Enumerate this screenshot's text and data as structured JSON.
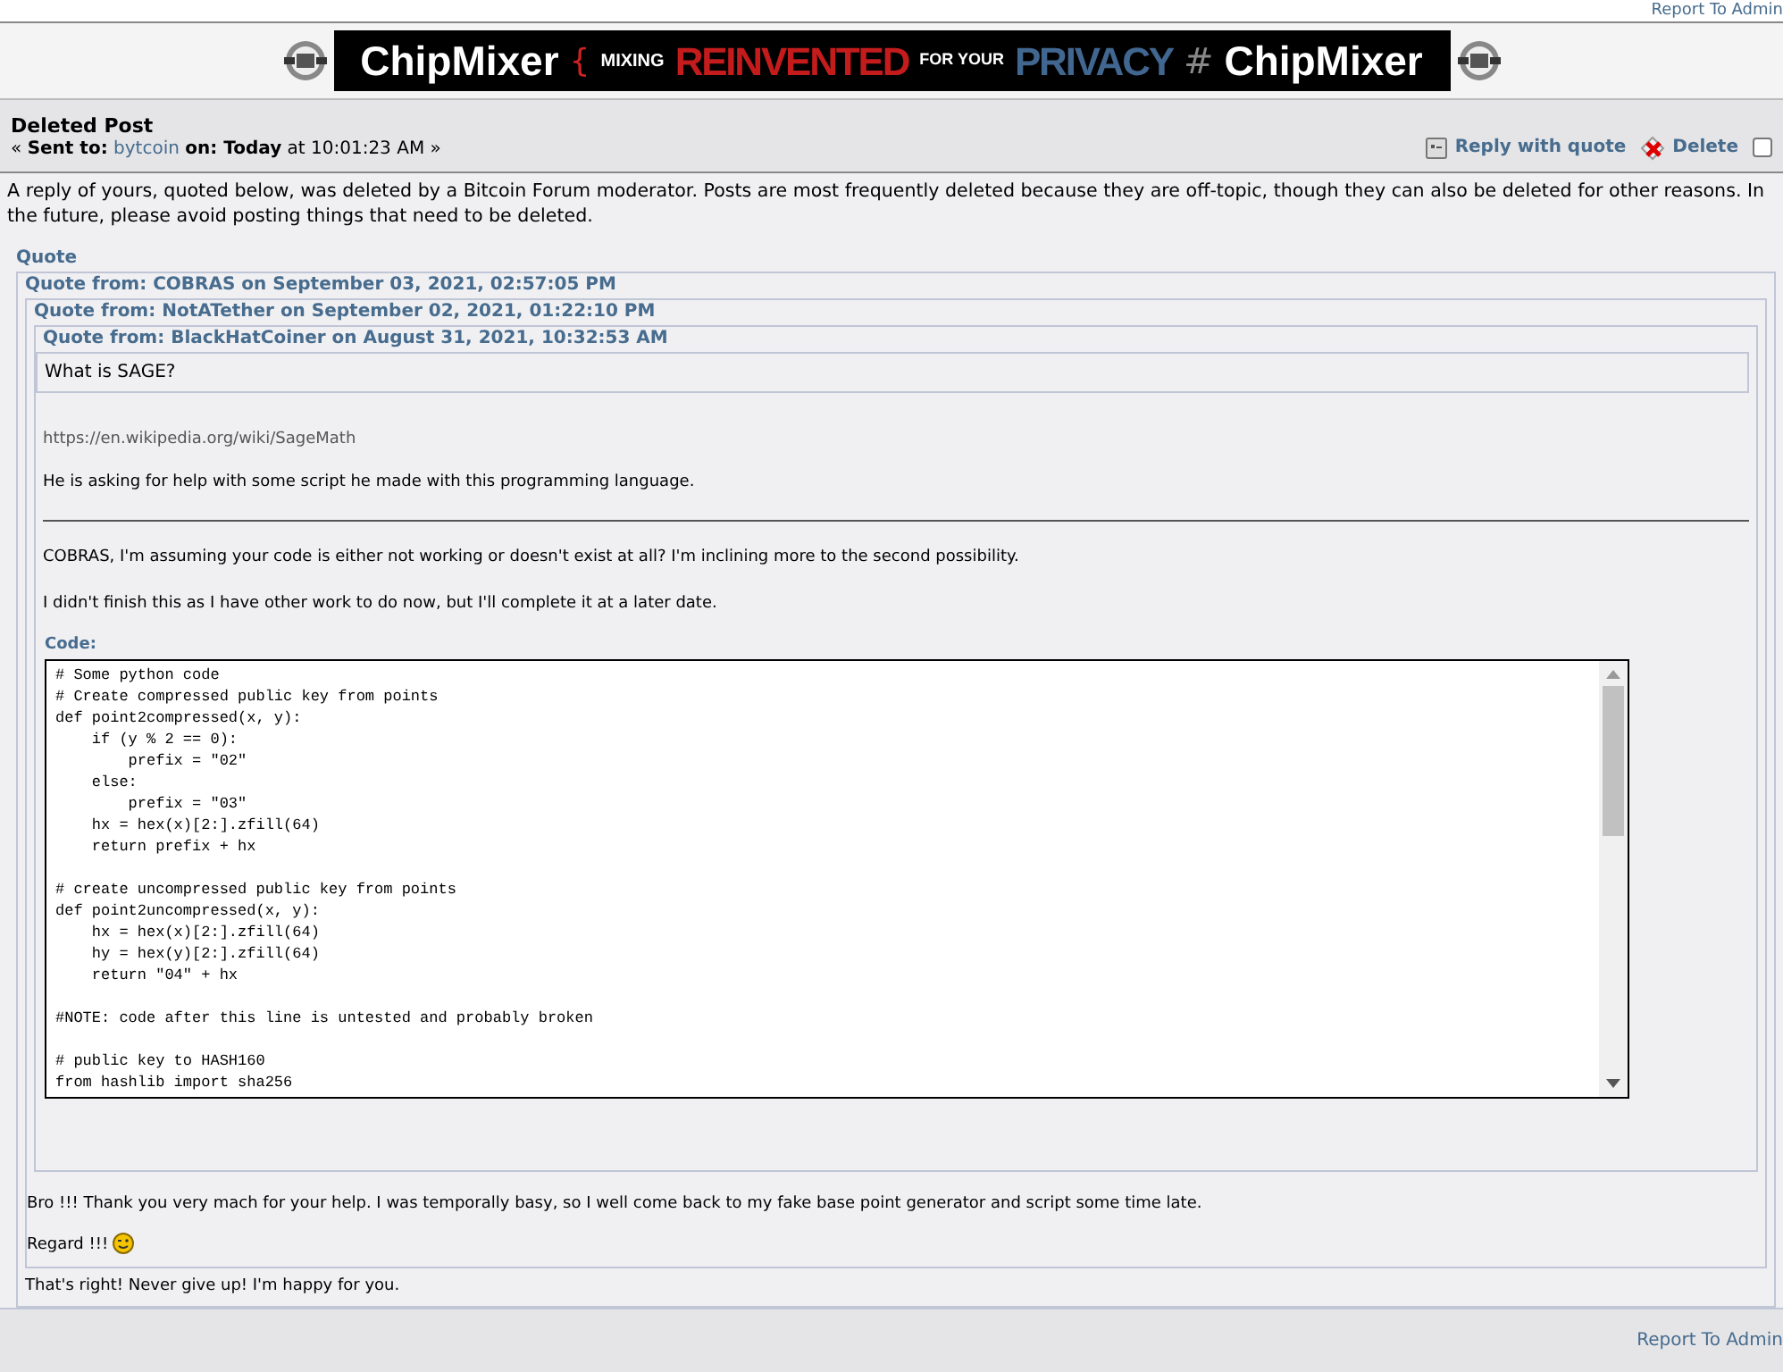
{
  "top_link": "Report To Admin",
  "banner": {
    "brand_left": "ChipMixer",
    "brace": "{",
    "word_1": "MIXING",
    "word_2": "REINVENTED",
    "word_3": "FOR YOUR",
    "word_4": "PRIVACY",
    "hash": "#",
    "brand_right": "ChipMixer"
  },
  "post": {
    "title": "Deleted Post",
    "meta_prefix": "«",
    "sent_to_label": "Sent to:",
    "recipient": "bytcoin",
    "on_label": "on:",
    "day": "Today",
    "time": "at 10:01:23 AM »",
    "reply_button": "Reply with quote",
    "delete_button": "Delete",
    "checked": false
  },
  "notice": "A reply of yours, quoted below, was deleted by a Bitcoin Forum moderator. Posts are most frequently deleted because they are off-topic, though they can also be deleted for other reasons. In the future, please avoid posting things that need to be deleted.",
  "quote_label": "Quote",
  "quote_1": {
    "header": "Quote from: COBRAS on September 03, 2021, 02:57:05 PM",
    "after": [
      "Bro !!! Thank you very mach for your help. I was temporally basy, so I well come back to my fake base point generator and script some time late."
    ],
    "last_line": "Regard !!!"
  },
  "quote_2": {
    "header": "Quote from: NotATether on September 02, 2021, 01:22:10 PM",
    "link": "https://en.wikipedia.org/wiki/SageMath",
    "line_1": "He is asking for help with some script he made with this programming language.",
    "line_2": "COBRAS, I'm assuming your code is either not working or doesn't exist at all? I'm inclining more to the second possibility.",
    "line_3": "I didn't finish this as I have other work to do now, but I'll complete it at a later date.",
    "code_label": "Code:"
  },
  "quote_3": {
    "header": "Quote from: BlackHatCoiner on August 31, 2021, 10:32:53 AM",
    "text": "What is SAGE?"
  },
  "code": [
    [
      "# Some python code",
      "# Create compressed public key from points",
      "def point2compressed(x, y):",
      "    if (y % 2 == 0):",
      "        prefix = \"02\"",
      "    else:",
      "        prefix = \"03\"",
      "    hx = hex(x)[2:].zfill(64)",
      "    return prefix + hx"
    ],
    [
      "# create uncompressed public key from points",
      "def point2uncompressed(x, y):",
      "    hx = hex(x)[2:].zfill(64)",
      "    hy = hex(y)[2:].zfill(64)",
      "    return \"04\" + hx"
    ],
    [
      "#NOTE: code after this line is untested and probably broken"
    ],
    [
      "# public key to HASH160",
      "from hashlib import sha256"
    ]
  ],
  "reply": "That's right! Never give up! I'm happy for you.",
  "bottom_link": "Report To Admin"
}
